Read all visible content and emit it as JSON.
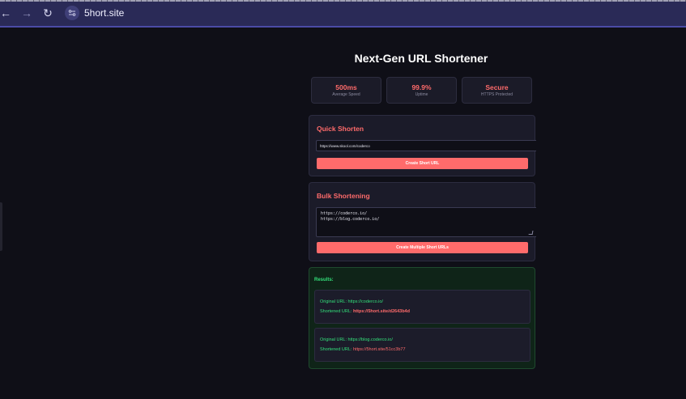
{
  "browser": {
    "url": "5hort.site",
    "back_icon": "←",
    "forward_icon": "→",
    "reload_icon": "↻"
  },
  "page": {
    "title": "Next-Gen URL Shortener"
  },
  "stats": [
    {
      "value": "500ms",
      "label": "Average Speed"
    },
    {
      "value": "99.9%",
      "label": "Uptime"
    },
    {
      "value": "Secure",
      "label": "HTTPS Protected"
    }
  ],
  "quick": {
    "heading": "Quick Shorten",
    "input_value": "https://www.skool.com/coderco",
    "button_label": "Create Short URL"
  },
  "bulk": {
    "heading": "Bulk Shortening",
    "textarea_value": "https://coderco.io/\nhttps://blog.coderco.io/",
    "button_label": "Create Multiple Short URLs"
  },
  "results": {
    "heading": "Results:",
    "items": [
      {
        "original_label": "Original URL:",
        "original_url": "https://coderco.io/",
        "short_label": "Shortened URL:",
        "short_url": "https://5hort.site/d2643b4d"
      },
      {
        "original_label": "Original URL:",
        "original_url": "https://blog.coderco.io/",
        "short_label": "Shortened URL:",
        "short_url": "https://5hort.site/51cc3b77"
      }
    ]
  },
  "colors": {
    "accent": "#ff6b6b",
    "success": "#33e07a",
    "background": "#0f0f17",
    "browser_bar": "#2a2a57"
  }
}
